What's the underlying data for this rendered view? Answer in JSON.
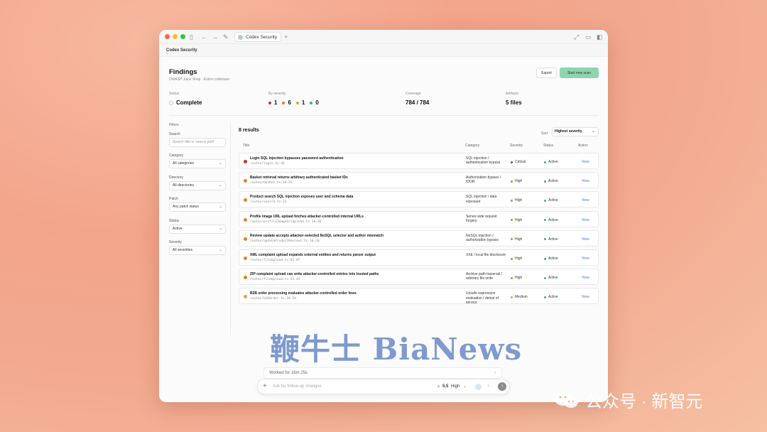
{
  "window": {
    "tab_label": "Codex Security",
    "app_title": "Codex Security"
  },
  "header": {
    "title": "Findings",
    "subtitle": "OWASP Juice Shop · Entire codebase",
    "export_label": "Export",
    "scan_label": "Start new scan"
  },
  "stats": {
    "status_label": "Status",
    "status_value": "Complete",
    "severity_label": "By severity",
    "severity_counts": [
      "1",
      "6",
      "1",
      "0"
    ],
    "severity_colors": [
      "#c0392b",
      "#e67e22",
      "#e8a13a",
      "#2eb872"
    ],
    "coverage_label": "Coverage",
    "coverage_value": "784 / 784",
    "artifacts_label": "Artifacts",
    "artifacts_value": "5 files"
  },
  "filters": {
    "heading": "Filters",
    "search_label": "Search",
    "search_placeholder": "Search title or source path",
    "category_label": "Category",
    "category_value": "All categories",
    "directory_label": "Directory",
    "directory_value": "All directories",
    "patch_label": "Patch",
    "patch_value": "Any patch status",
    "status_label": "Status",
    "status_value": "Active",
    "severity_label": "Severity",
    "severity_value": "All severities"
  },
  "results": {
    "count_label": "8 results",
    "sort_label": "Sort",
    "sort_value": "Highest severity",
    "columns": [
      "Title",
      "Category",
      "Severity",
      "Status",
      "Action"
    ]
  },
  "chart_data": {
    "type": "table",
    "columns": [
      "Title",
      "Category",
      "Severity",
      "Status",
      "Action"
    ],
    "rows": [
      {
        "title": "Login SQL injection bypasses password authentication",
        "path": "routes/login.ts:34",
        "category": "SQL injection / authentication bypass",
        "severity": "Critical",
        "sev_color": "#c0392b",
        "status": "Active",
        "action": "View"
      },
      {
        "title": "Basket retrieval returns arbitrary authenticated basket IDs",
        "path": "routes/basket.ts:18-31",
        "category": "Authorization bypass / IDOR",
        "severity": "High",
        "sev_color": "#e67e22",
        "status": "Active",
        "action": "View"
      },
      {
        "title": "Product search SQL injection exposes user and schema data",
        "path": "routes/search.ts:23",
        "category": "SQL injection / data exposure",
        "severity": "High",
        "sev_color": "#e67e22",
        "status": "Active",
        "action": "View"
      },
      {
        "title": "Profile image URL upload fetches attacker-controlled internal URLs",
        "path": "routes/profileImageUrlUpload.ts:18-30",
        "category": "Server-side request forgery",
        "severity": "High",
        "sev_color": "#e67e22",
        "status": "Active",
        "action": "View"
      },
      {
        "title": "Review update accepts attacker-selected NoSQL selector and author mismatch",
        "path": "routes/updateProductReviews.ts:16-20",
        "category": "NoSQL injection / authorization bypass",
        "severity": "High",
        "sev_color": "#e67e22",
        "status": "Active",
        "action": "View"
      },
      {
        "title": "XML complaint upload expands external entities and returns parser output",
        "path": "routes/fileUpload.ts:81-87",
        "category": "XXE / local file disclosure",
        "severity": "High",
        "sev_color": "#e67e22",
        "status": "Active",
        "action": "View"
      },
      {
        "title": "ZIP complaint upload can write attacker-controlled entries into trusted paths",
        "path": "routes/fileUpload.ts:41-45",
        "category": "Archive path traversal / arbitrary file write",
        "severity": "High",
        "sev_color": "#e67e22",
        "status": "Active",
        "action": "View"
      },
      {
        "title": "B2B order processing evaluates attacker-controlled order lines",
        "path": "routes/b2bOrder.ts:16-24",
        "category": "Unsafe expression evaluation / denial of service",
        "severity": "Medium",
        "sev_color": "#e8a13a",
        "status": "Active",
        "action": "View"
      }
    ]
  },
  "composer": {
    "worked_label": "Worked for 16m 25s",
    "placeholder": "Ask for follow-up changes",
    "model_label": "5.5",
    "effort_label": "High"
  },
  "watermark": {
    "text": "鞭牛士 BiaNews"
  },
  "wechat": {
    "text": "公众号 · 新智元"
  }
}
